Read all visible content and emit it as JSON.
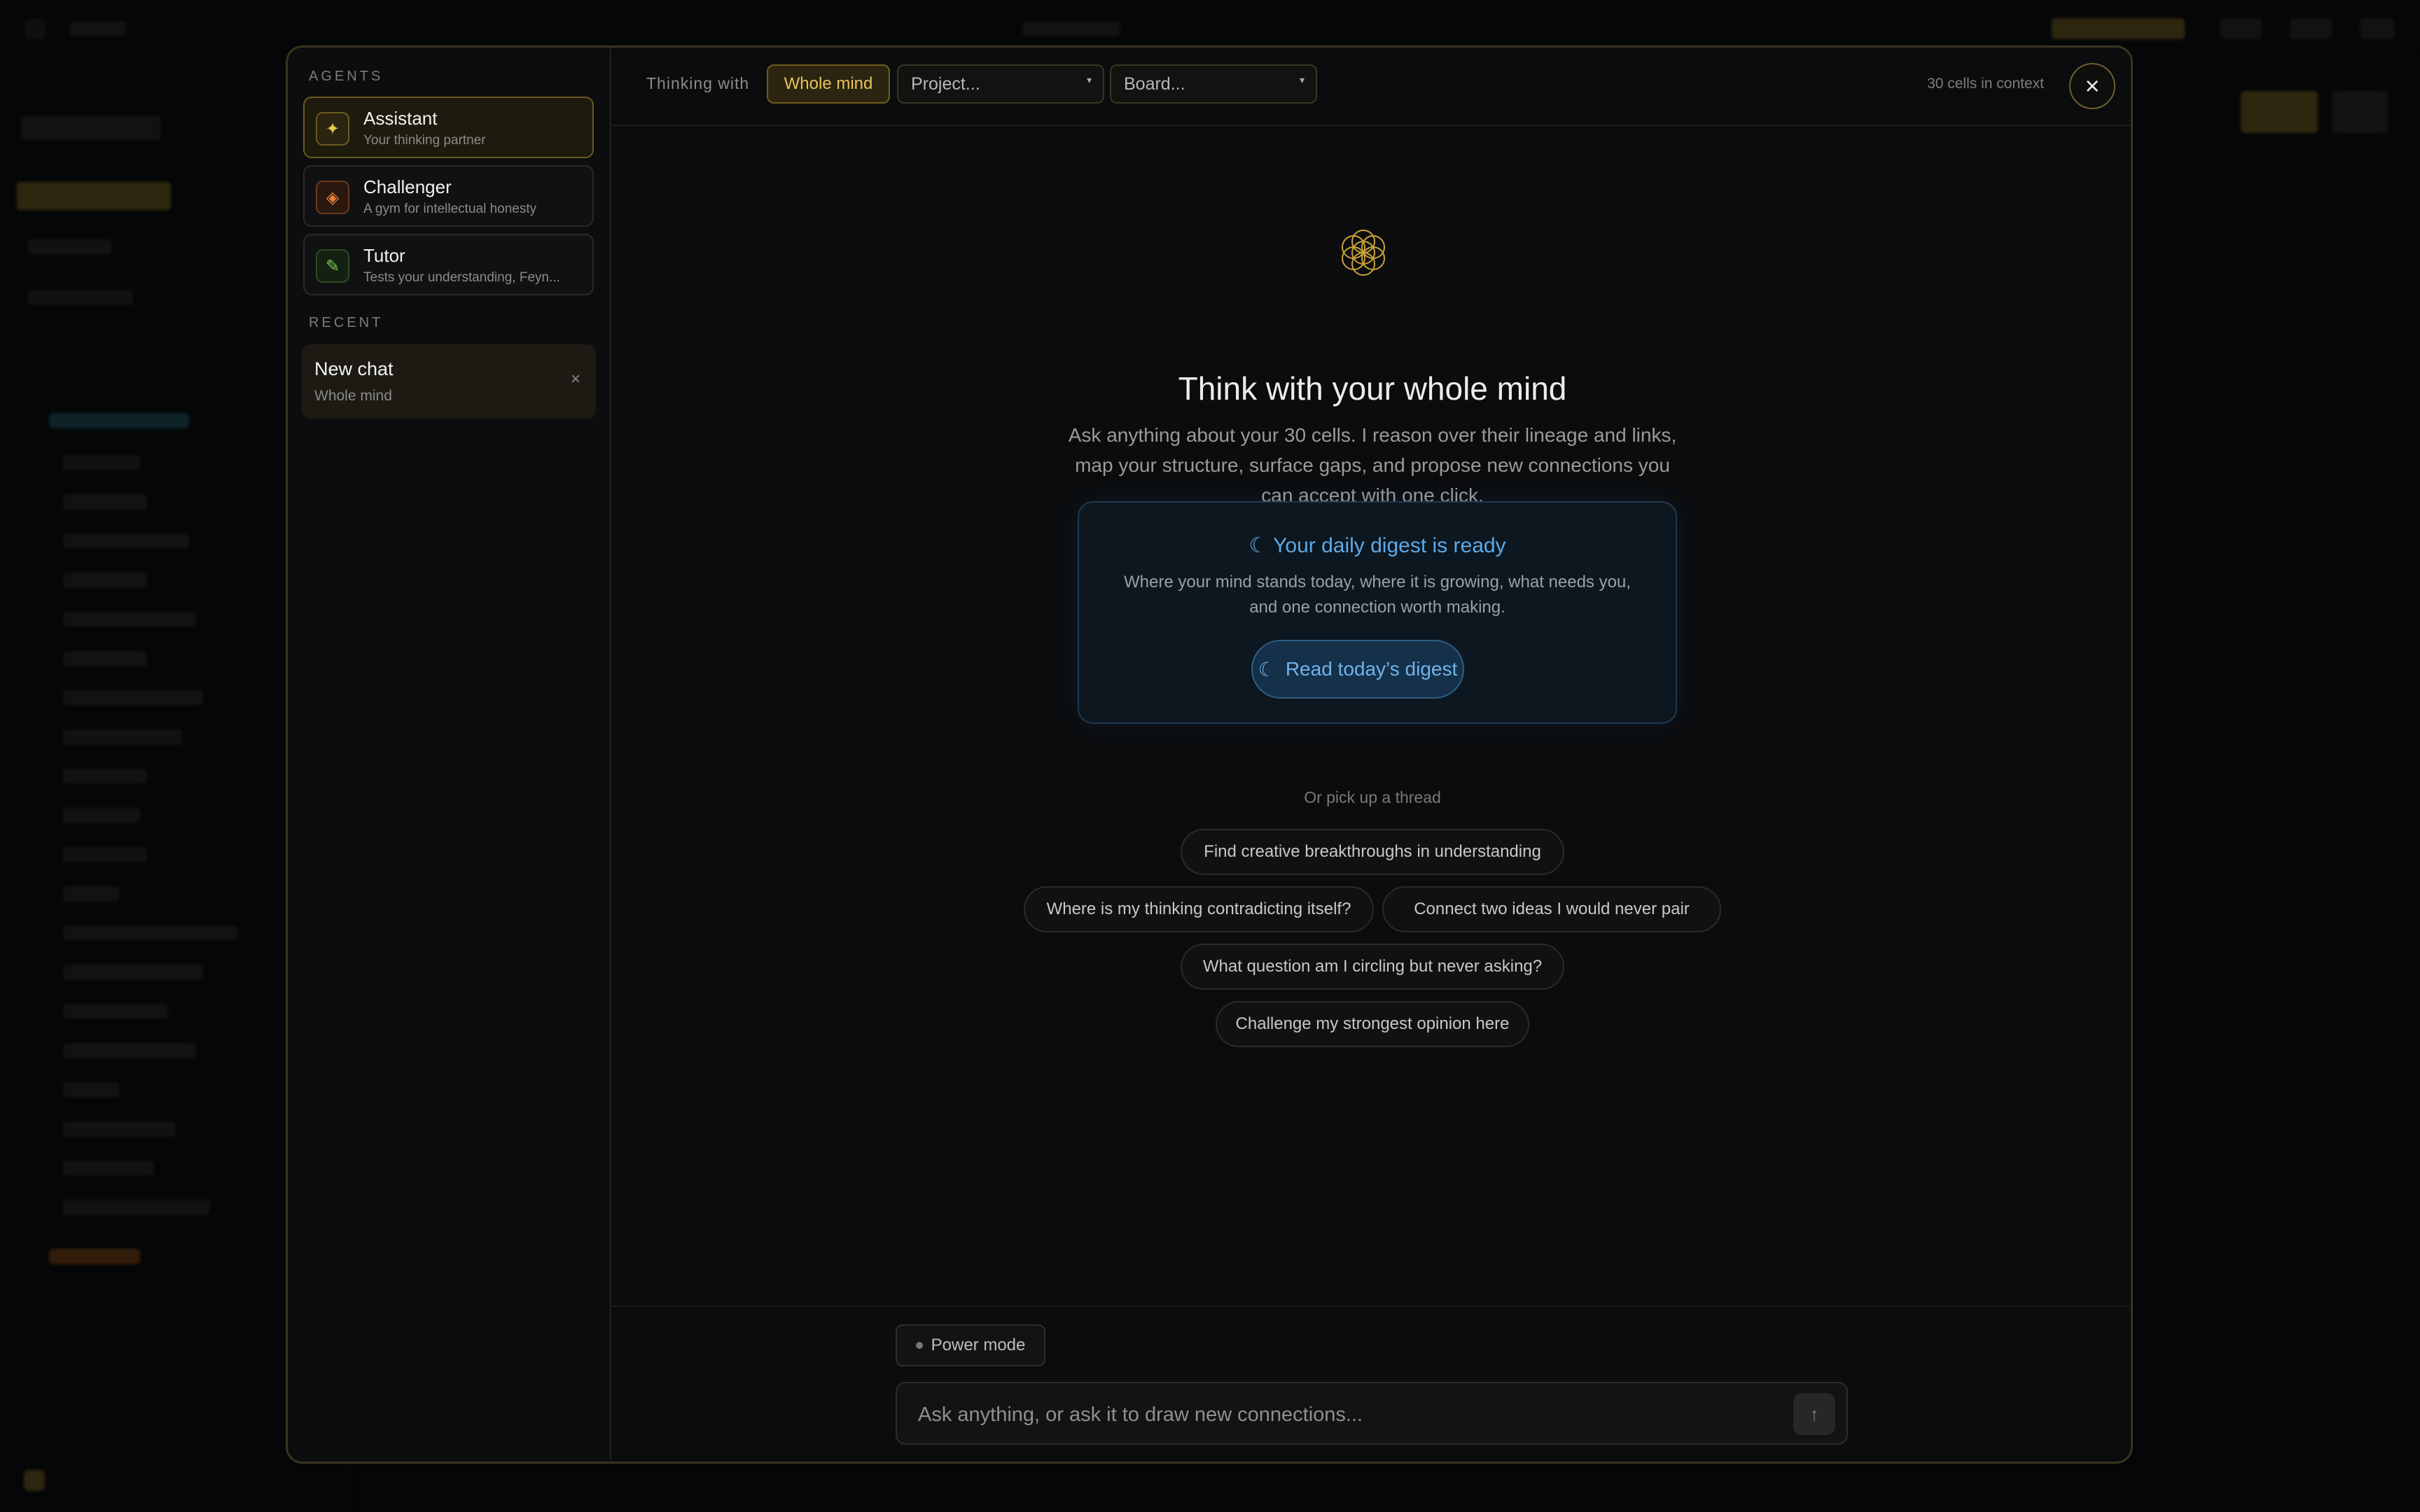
{
  "sidebar": {
    "agents_label": "AGENTS",
    "agents": [
      {
        "name": "Assistant",
        "desc": "Your thinking partner",
        "icon": "sparkle-icon",
        "color": "#e9c44a"
      },
      {
        "name": "Challenger",
        "desc": "A gym for intellectual honesty",
        "icon": "diamond-icon",
        "color": "#e8813a"
      },
      {
        "name": "Tutor",
        "desc": "Tests your understanding, Feyn...",
        "icon": "pencil-icon",
        "color": "#7fcf56"
      }
    ],
    "recent_label": "RECENT",
    "recent": [
      {
        "title": "New chat",
        "sub": "Whole mind"
      }
    ]
  },
  "topbar": {
    "thinking_label": "Thinking with",
    "whole_mind": "Whole mind",
    "project_select": "Project...",
    "board_select": "Board...",
    "context_count": "30 cells in context"
  },
  "hero": {
    "title": "Think with your whole mind",
    "description": "Ask anything about your 30 cells. I reason over their lineage and links, map your structure, surface gaps, and propose new connections you can accept with one click."
  },
  "digest": {
    "title": "Your daily digest is ready",
    "description": "Where your mind stands today, where it is growing, what needs you, and one connection worth making.",
    "button": "Read today’s digest"
  },
  "threads": {
    "label": "Or pick up a thread",
    "items": [
      "Find creative breakthroughs in understanding",
      "Where is my thinking contradicting itself?",
      "Connect two ideas I would never pair",
      "What question am I circling but never asking?",
      "Challenge my strongest opinion here"
    ]
  },
  "composer": {
    "power_mode": "Power mode",
    "placeholder": "Ask anything, or ask it to draw new connections..."
  },
  "colors": {
    "accent_gold": "#e8c25a",
    "accent_blue": "#5ea9e6"
  }
}
